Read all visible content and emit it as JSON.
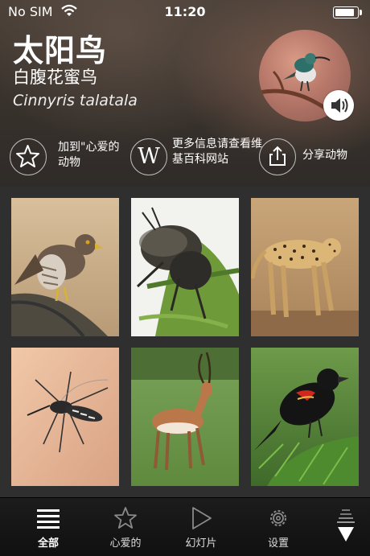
{
  "status_bar": {
    "carrier": "No SIM",
    "time": "11:20",
    "battery_level": 0.95
  },
  "animal": {
    "name": "太阳鸟",
    "common_name": "白腹花蜜鸟",
    "scientific_name": "Cinnyris talatala"
  },
  "actions": {
    "favorite_label": "加到\"心爱的动物",
    "wikipedia_label": "更多信息请查看维基百科网站",
    "wikipedia_icon_text": "W",
    "share_label": "分享动物"
  },
  "gallery": [
    {
      "icon": "hawk-photo"
    },
    {
      "icon": "cricket-photo"
    },
    {
      "icon": "cheetah-photo"
    },
    {
      "icon": "mosquito-photo"
    },
    {
      "icon": "impala-photo"
    },
    {
      "icon": "blackbird-photo"
    }
  ],
  "tabbar": {
    "all_label": "全部",
    "favorites_label": "心爱的",
    "slideshow_label": "幻灯片",
    "settings_label": "设置"
  }
}
